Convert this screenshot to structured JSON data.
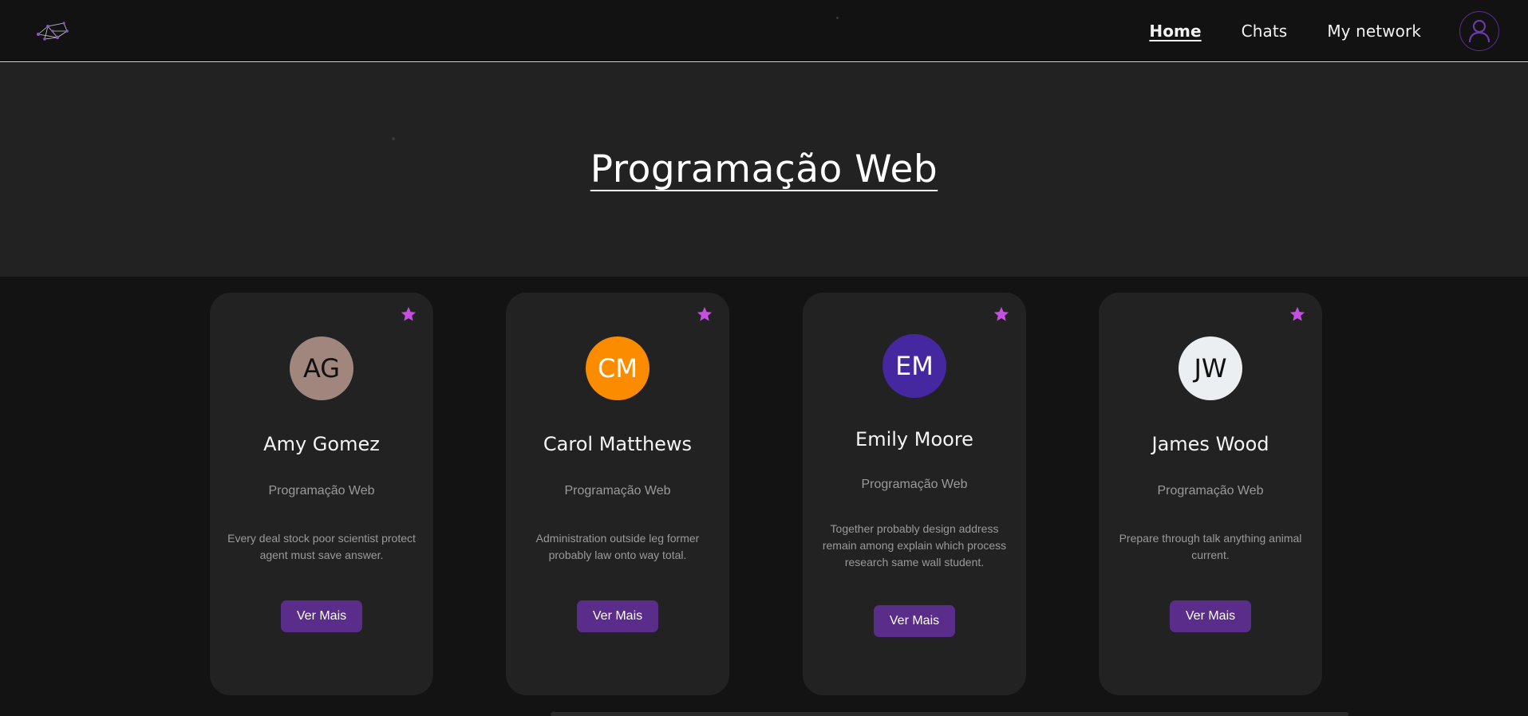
{
  "header": {
    "nav": [
      {
        "label": "Home",
        "active": true
      },
      {
        "label": "Chats",
        "active": false
      },
      {
        "label": "My network",
        "active": false
      }
    ],
    "logo_icon": "network-graph-logo",
    "profile_icon": "user-icon"
  },
  "hero": {
    "title": "Programação Web"
  },
  "cards": [
    {
      "initials": "AG",
      "avatar_color": "#a1867e",
      "initials_color": "#111111",
      "name": "Amy Gomez",
      "course": "Programação Web",
      "description": "Every deal stock poor scientist protect agent must save answer.",
      "button": "Ver Mais"
    },
    {
      "initials": "CM",
      "avatar_color": "#fb8c00",
      "initials_color": "#ffffff",
      "name": "Carol Matthews",
      "course": "Programação Web",
      "description": "Administration outside leg former probably law onto way total.",
      "button": "Ver Mais"
    },
    {
      "initials": "EM",
      "avatar_color": "#4527a0",
      "initials_color": "#ffffff",
      "name": "Emily Moore",
      "course": "Programação Web",
      "description": "Together probably design address remain among explain which process research same wall student.",
      "button": "Ver Mais"
    },
    {
      "initials": "JW",
      "avatar_color": "#eceff1",
      "initials_color": "#111111",
      "name": "James Wood",
      "course": "Programação Web",
      "description": "Prepare through talk anything animal current.",
      "button": "Ver Mais"
    }
  ],
  "colors": {
    "accent": "#5b2d8b",
    "star": "#c44fe0",
    "header_bg": "#121212",
    "hero_bg": "#222222",
    "card_bg": "#222223"
  }
}
